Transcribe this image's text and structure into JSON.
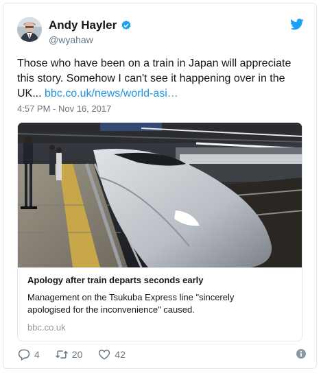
{
  "user": {
    "name": "Andy Hayler",
    "handle": "@wyahaw"
  },
  "tweet": {
    "text_before_link": "Those who have been on a train in Japan will appreciate this story. Somehow I can't see it happening over in the UK... ",
    "link": "bbc.co.uk/news/world-asi…",
    "timestamp": "4:57 PM - Nov 16, 2017"
  },
  "card": {
    "title": "Apology after train departs seconds early",
    "description": "Management on the Tsukuba Express line \"sincerely apologised for the inconvenience\" caused.",
    "domain": "bbc.co.uk",
    "image_icon": "bullet-train-photo"
  },
  "actions": {
    "replies": "4",
    "retweets": "20",
    "likes": "42"
  },
  "colors": {
    "link": "#1b95e0",
    "verified": "#1da1f2",
    "muted": "#657786"
  }
}
